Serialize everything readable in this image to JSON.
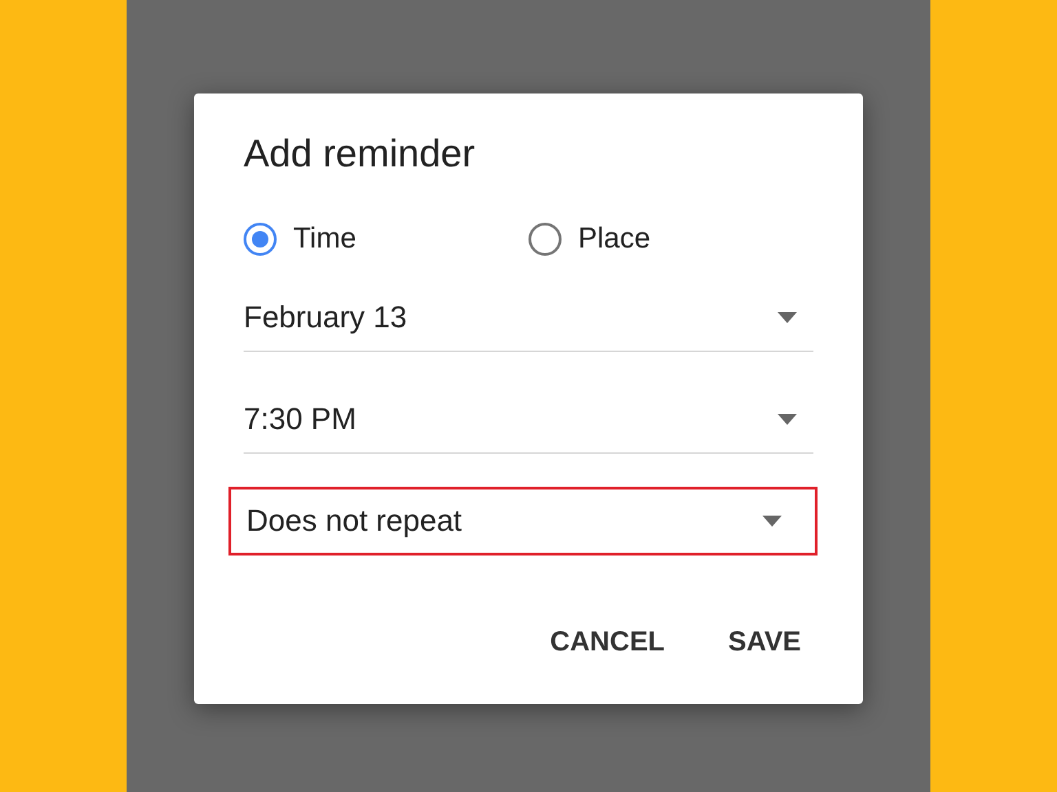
{
  "dialog": {
    "title": "Add reminder",
    "options": [
      {
        "label": "Time",
        "selected": true
      },
      {
        "label": "Place",
        "selected": false
      }
    ],
    "fields": [
      {
        "value": "February 13",
        "highlighted": false
      },
      {
        "value": "7:30 PM",
        "highlighted": false
      },
      {
        "value": "Does not repeat",
        "highlighted": true
      }
    ],
    "buttons": [
      "CANCEL",
      "SAVE"
    ]
  }
}
